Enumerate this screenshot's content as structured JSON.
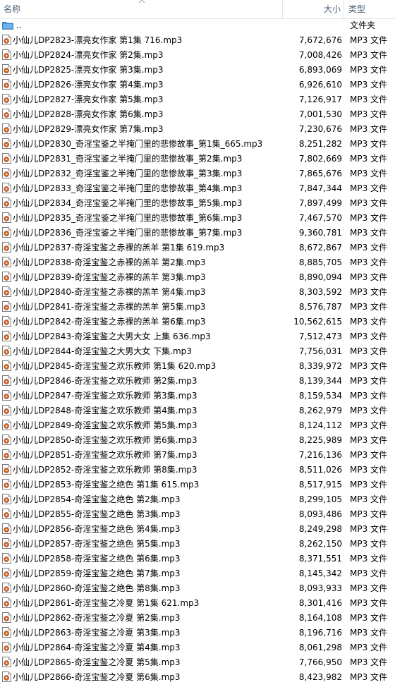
{
  "header": {
    "name": "名称",
    "size": "大小",
    "type": "类型"
  },
  "parent": {
    "name": "..",
    "type": "文件夹"
  },
  "files": [
    {
      "name": "小仙儿DP2823-漂亮女作家 第1集 716.mp3",
      "size": "7,672,676",
      "type": "MP3 文件"
    },
    {
      "name": "小仙儿DP2824-漂亮女作家 第2集.mp3",
      "size": "7,008,426",
      "type": "MP3 文件"
    },
    {
      "name": "小仙儿DP2825-漂亮女作家 第3集.mp3",
      "size": "6,893,069",
      "type": "MP3 文件"
    },
    {
      "name": "小仙儿DP2826-漂亮女作家 第4集.mp3",
      "size": "6,926,610",
      "type": "MP3 文件"
    },
    {
      "name": "小仙儿DP2827-漂亮女作家 第5集.mp3",
      "size": "7,126,917",
      "type": "MP3 文件"
    },
    {
      "name": "小仙儿DP2828-漂亮女作家 第6集.mp3",
      "size": "7,001,530",
      "type": "MP3 文件"
    },
    {
      "name": "小仙儿DP2829-漂亮女作家 第7集.mp3",
      "size": "7,230,676",
      "type": "MP3 文件"
    },
    {
      "name": "小仙儿DP2830_奇淫宝鉴之半掩门里的悲惨故事_第1集_665.mp3",
      "size": "8,251,282",
      "type": "MP3 文件"
    },
    {
      "name": "小仙儿DP2831_奇淫宝鉴之半掩门里的悲惨故事_第2集.mp3",
      "size": "7,802,669",
      "type": "MP3 文件"
    },
    {
      "name": "小仙儿DP2832_奇淫宝鉴之半掩门里的悲惨故事_第3集.mp3",
      "size": "7,865,676",
      "type": "MP3 文件"
    },
    {
      "name": "小仙儿DP2833_奇淫宝鉴之半掩门里的悲惨故事_第4集.mp3",
      "size": "7,847,344",
      "type": "MP3 文件"
    },
    {
      "name": "小仙儿DP2834_奇淫宝鉴之半掩门里的悲惨故事_第5集.mp3",
      "size": "7,897,499",
      "type": "MP3 文件"
    },
    {
      "name": "小仙儿DP2835_奇淫宝鉴之半掩门里的悲惨故事_第6集.mp3",
      "size": "7,467,570",
      "type": "MP3 文件"
    },
    {
      "name": "小仙儿DP2836_奇淫宝鉴之半掩门里的悲惨故事_第7集.mp3",
      "size": "9,360,781",
      "type": "MP3 文件"
    },
    {
      "name": "小仙儿DP2837-奇淫宝鉴之赤裸的羔羊 第1集 619.mp3",
      "size": "8,672,867",
      "type": "MP3 文件"
    },
    {
      "name": "小仙儿DP2838-奇淫宝鉴之赤裸的羔羊 第2集.mp3",
      "size": "8,885,705",
      "type": "MP3 文件"
    },
    {
      "name": "小仙儿DP2839-奇淫宝鉴之赤裸的羔羊 第3集.mp3",
      "size": "8,890,094",
      "type": "MP3 文件"
    },
    {
      "name": "小仙儿DP2840-奇淫宝鉴之赤裸的羔羊 第4集.mp3",
      "size": "8,303,592",
      "type": "MP3 文件"
    },
    {
      "name": "小仙儿DP2841-奇淫宝鉴之赤裸的羔羊 第5集.mp3",
      "size": "8,576,787",
      "type": "MP3 文件"
    },
    {
      "name": "小仙儿DP2842-奇淫宝鉴之赤裸的羔羊 第6集.mp3",
      "size": "10,562,615",
      "type": "MP3 文件"
    },
    {
      "name": "小仙儿DP2843-奇淫宝鉴之大男大女 上集 636.mp3",
      "size": "7,512,473",
      "type": "MP3 文件"
    },
    {
      "name": "小仙儿DP2844-奇淫宝鉴之大男大女 下集.mp3",
      "size": "7,756,031",
      "type": "MP3 文件"
    },
    {
      "name": "小仙儿DP2845-奇淫宝鉴之欢乐教师 第1集 620.mp3",
      "size": "8,339,972",
      "type": "MP3 文件"
    },
    {
      "name": "小仙儿DP2846-奇淫宝鉴之欢乐教师 第2集.mp3",
      "size": "8,139,344",
      "type": "MP3 文件"
    },
    {
      "name": "小仙儿DP2847-奇淫宝鉴之欢乐教师 第3集.mp3",
      "size": "8,159,534",
      "type": "MP3 文件"
    },
    {
      "name": "小仙儿DP2848-奇淫宝鉴之欢乐教师 第4集.mp3",
      "size": "8,262,979",
      "type": "MP3 文件"
    },
    {
      "name": "小仙儿DP2849-奇淫宝鉴之欢乐教师 第5集.mp3",
      "size": "8,124,112",
      "type": "MP3 文件"
    },
    {
      "name": "小仙儿DP2850-奇淫宝鉴之欢乐教师 第6集.mp3",
      "size": "8,225,989",
      "type": "MP3 文件"
    },
    {
      "name": "小仙儿DP2851-奇淫宝鉴之欢乐教师 第7集.mp3",
      "size": "7,216,136",
      "type": "MP3 文件"
    },
    {
      "name": "小仙儿DP2852-奇淫宝鉴之欢乐教师 第8集.mp3",
      "size": "8,511,026",
      "type": "MP3 文件"
    },
    {
      "name": "小仙儿DP2853-奇淫宝鉴之绝色 第1集 615.mp3",
      "size": "8,517,915",
      "type": "MP3 文件"
    },
    {
      "name": "小仙儿DP2854-奇淫宝鉴之绝色 第2集.mp3",
      "size": "8,299,105",
      "type": "MP3 文件"
    },
    {
      "name": "小仙儿DP2855-奇淫宝鉴之绝色 第3集.mp3",
      "size": "8,093,486",
      "type": "MP3 文件"
    },
    {
      "name": "小仙儿DP2856-奇淫宝鉴之绝色 第4集.mp3",
      "size": "8,249,298",
      "type": "MP3 文件"
    },
    {
      "name": "小仙儿DP2857-奇淫宝鉴之绝色 第5集.mp3",
      "size": "8,262,150",
      "type": "MP3 文件"
    },
    {
      "name": "小仙儿DP2858-奇淫宝鉴之绝色 第6集.mp3",
      "size": "8,371,551",
      "type": "MP3 文件"
    },
    {
      "name": "小仙儿DP2859-奇淫宝鉴之绝色 第7集.mp3",
      "size": "8,145,342",
      "type": "MP3 文件"
    },
    {
      "name": "小仙儿DP2860-奇淫宝鉴之绝色 第8集.mp3",
      "size": "8,093,933",
      "type": "MP3 文件"
    },
    {
      "name": "小仙儿DP2861-奇淫宝鉴之冷夏 第1集 621.mp3",
      "size": "8,301,416",
      "type": "MP3 文件"
    },
    {
      "name": "小仙儿DP2862-奇淫宝鉴之冷夏 第2集.mp3",
      "size": "8,164,108",
      "type": "MP3 文件"
    },
    {
      "name": "小仙儿DP2863-奇淫宝鉴之冷夏 第3集.mp3",
      "size": "8,196,716",
      "type": "MP3 文件"
    },
    {
      "name": "小仙儿DP2864-奇淫宝鉴之冷夏 第4集.mp3",
      "size": "8,061,298",
      "type": "MP3 文件"
    },
    {
      "name": "小仙儿DP2865-奇淫宝鉴之冷夏 第5集.mp3",
      "size": "7,766,950",
      "type": "MP3 文件"
    },
    {
      "name": "小仙儿DP2866-奇淫宝鉴之冷夏 第6集.mp3",
      "size": "8,423,982",
      "type": "MP3 文件"
    }
  ],
  "icons": {
    "parent": "folder-up-icon",
    "file": "audio-file-icon",
    "sort": "sort-ascending-icon"
  },
  "colors": {
    "header_text": "#4c607a",
    "divider": "#e5e5e5",
    "folder": "#3c8fd8"
  }
}
